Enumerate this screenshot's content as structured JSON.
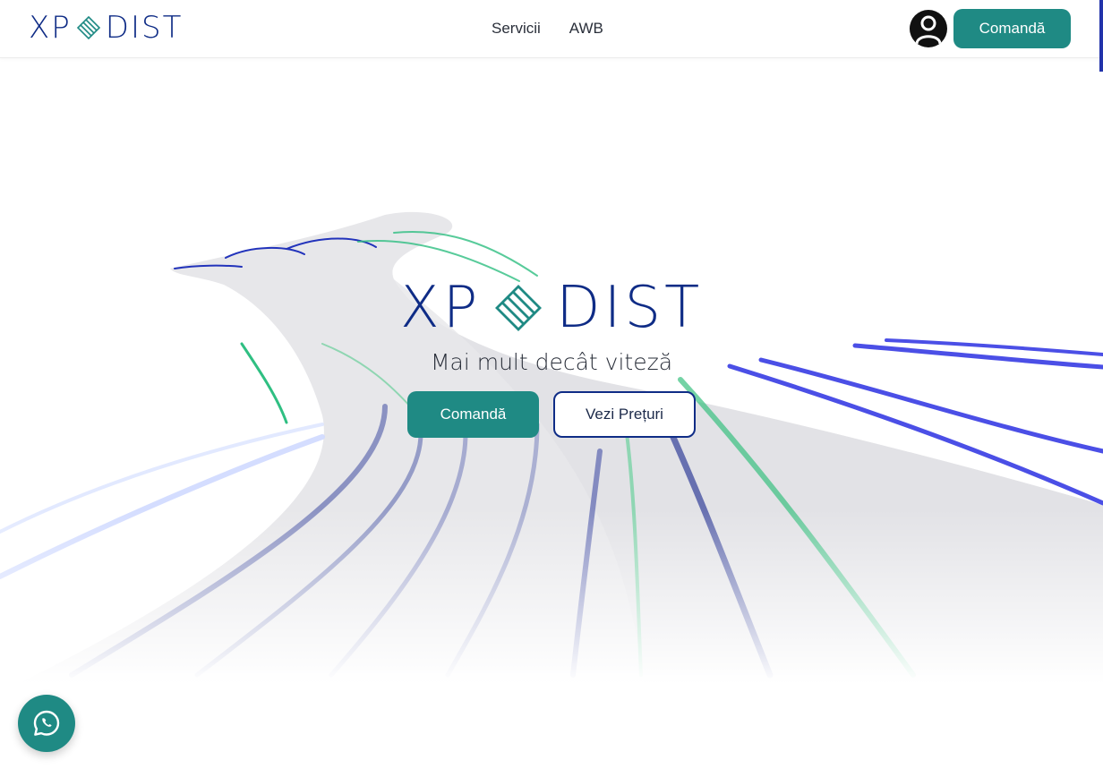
{
  "header": {
    "logo_left": "XP",
    "logo_right": "DIST",
    "nav": [
      {
        "label": "Servicii"
      },
      {
        "label": "AWB"
      }
    ],
    "cta_label": "Comandă"
  },
  "hero": {
    "logo_left": "XP",
    "logo_right": "DIST",
    "tagline": "Mai mult decât viteză",
    "primary_label": "Comandă",
    "secondary_label": "Vezi Prețuri"
  },
  "colors": {
    "brand_navy": "#0f2c86",
    "brand_teal": "#1f8a84"
  },
  "icons": {
    "user": "user-icon",
    "whatsapp": "whatsapp-icon",
    "logo_mark": "logo-mark-icon"
  }
}
